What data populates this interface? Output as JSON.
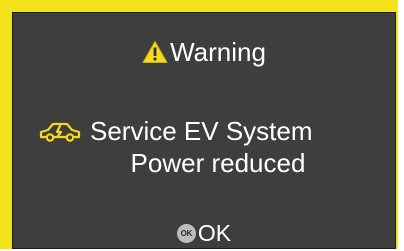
{
  "dialog": {
    "title": "Warning",
    "title_icon": "warning-triangle-icon",
    "message_icon": "ev-system-warning-icon",
    "message_line1": "Service EV System",
    "message_line2": "Power reduced",
    "ok_badge": "OK",
    "ok_label": "OK"
  },
  "colors": {
    "frame": "#f2e31d",
    "screen_background": "#3e3e3e",
    "text": "#ffffff",
    "warning_icon": "#f2dc1d"
  }
}
